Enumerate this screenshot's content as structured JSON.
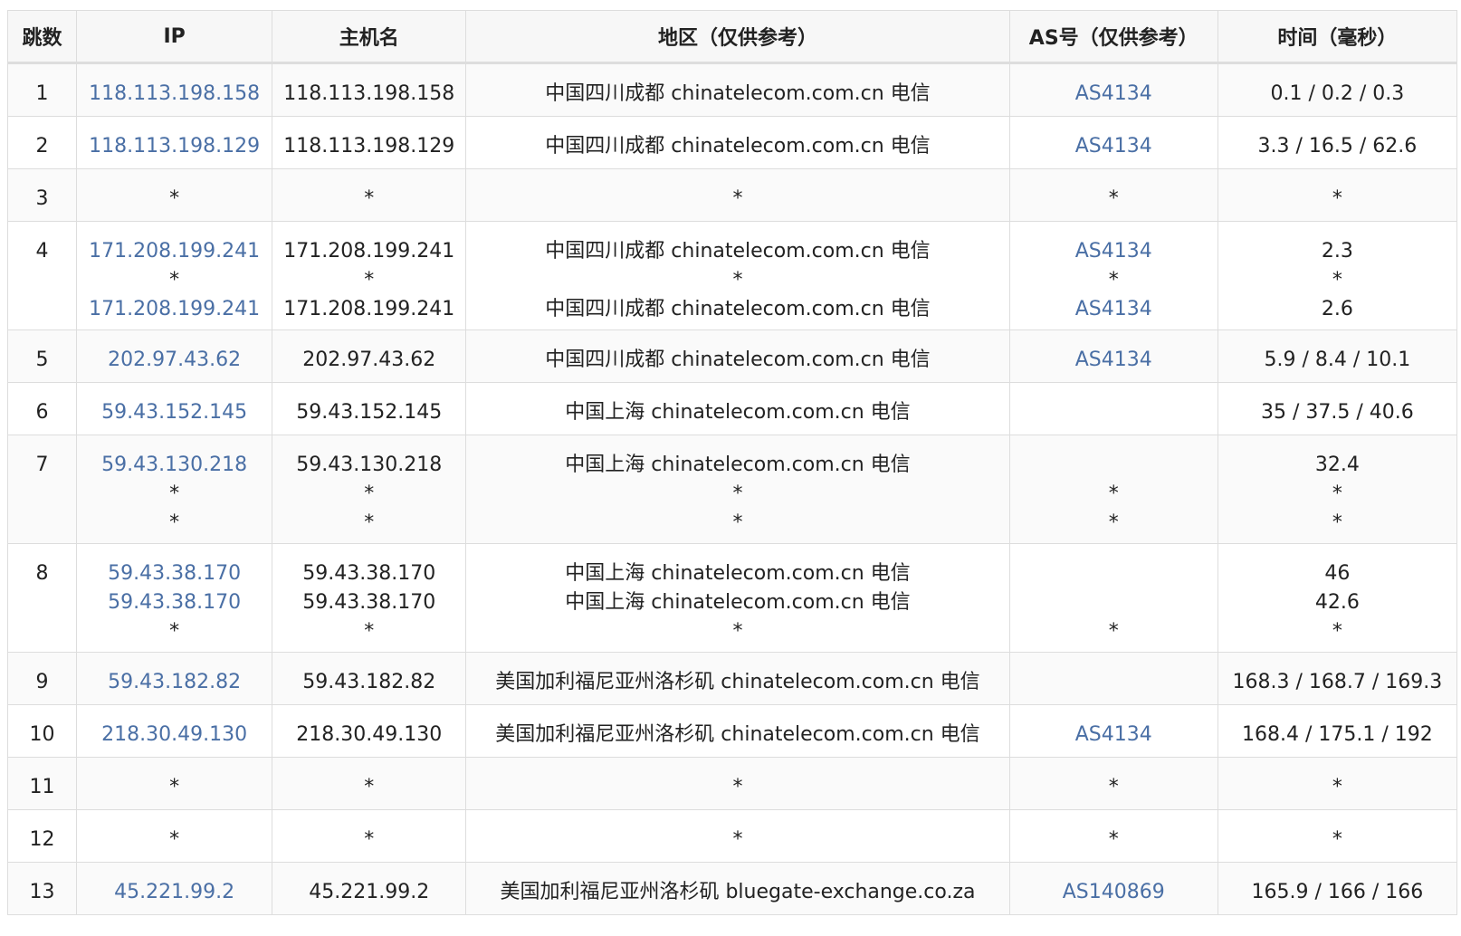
{
  "table": {
    "headers": [
      "跳数",
      "IP",
      "主机名",
      "地区（仅供参考）",
      "AS号（仅供参考）",
      "时间（毫秒）"
    ],
    "rows": [
      {
        "hop": "1",
        "lines": 1,
        "ip": [
          "118.113.198.158"
        ],
        "host": [
          "118.113.198.158"
        ],
        "region": [
          "中国四川成都 chinatelecom.com.cn 电信"
        ],
        "as": [
          "AS4134"
        ],
        "time": [
          "0.1 / 0.2 / 0.3"
        ]
      },
      {
        "hop": "2",
        "lines": 1,
        "ip": [
          "118.113.198.129"
        ],
        "host": [
          "118.113.198.129"
        ],
        "region": [
          "中国四川成都 chinatelecom.com.cn 电信"
        ],
        "as": [
          "AS4134"
        ],
        "time": [
          "3.3 / 16.5 / 62.6"
        ]
      },
      {
        "hop": "3",
        "lines": 1,
        "ip": [
          "*"
        ],
        "host": [
          "*"
        ],
        "region": [
          "*"
        ],
        "as": [
          "*"
        ],
        "time": [
          "*"
        ]
      },
      {
        "hop": "4",
        "lines": 3,
        "ip": [
          "171.208.199.241",
          "*",
          "171.208.199.241"
        ],
        "host": [
          "171.208.199.241",
          "*",
          "171.208.199.241"
        ],
        "region": [
          "中国四川成都 chinatelecom.com.cn 电信",
          "*",
          "中国四川成都 chinatelecom.com.cn 电信"
        ],
        "as": [
          "AS4134",
          "*",
          "AS4134"
        ],
        "time": [
          "2.3",
          "*",
          "2.6"
        ]
      },
      {
        "hop": "5",
        "lines": 1,
        "ip": [
          "202.97.43.62"
        ],
        "host": [
          "202.97.43.62"
        ],
        "region": [
          "中国四川成都 chinatelecom.com.cn 电信"
        ],
        "as": [
          "AS4134"
        ],
        "time": [
          "5.9 / 8.4 / 10.1"
        ]
      },
      {
        "hop": "6",
        "lines": 1,
        "ip": [
          "59.43.152.145"
        ],
        "host": [
          "59.43.152.145"
        ],
        "region": [
          "中国上海 chinatelecom.com.cn 电信"
        ],
        "as": [
          ""
        ],
        "time": [
          "35 / 37.5 / 40.6"
        ]
      },
      {
        "hop": "7",
        "lines": 3,
        "ip": [
          "59.43.130.218",
          "*",
          "*"
        ],
        "host": [
          "59.43.130.218",
          "*",
          "*"
        ],
        "region": [
          "中国上海 chinatelecom.com.cn 电信",
          "*",
          "*"
        ],
        "as": [
          "",
          "*",
          "*"
        ],
        "time": [
          "32.4",
          "*",
          "*"
        ]
      },
      {
        "hop": "8",
        "lines": 3,
        "ip": [
          "59.43.38.170",
          "59.43.38.170",
          "*"
        ],
        "host": [
          "59.43.38.170",
          "59.43.38.170",
          "*"
        ],
        "region": [
          "中国上海 chinatelecom.com.cn 电信",
          "中国上海 chinatelecom.com.cn 电信",
          "*"
        ],
        "as": [
          "",
          "",
          "*"
        ],
        "time": [
          "46",
          "42.6",
          "*"
        ]
      },
      {
        "hop": "9",
        "lines": 1,
        "ip": [
          "59.43.182.82"
        ],
        "host": [
          "59.43.182.82"
        ],
        "region": [
          "美国加利福尼亚州洛杉矶 chinatelecom.com.cn 电信"
        ],
        "as": [
          ""
        ],
        "time": [
          "168.3 / 168.7 / 169.3"
        ]
      },
      {
        "hop": "10",
        "lines": 1,
        "ip": [
          "218.30.49.130"
        ],
        "host": [
          "218.30.49.130"
        ],
        "region": [
          "美国加利福尼亚州洛杉矶 chinatelecom.com.cn 电信"
        ],
        "as": [
          "AS4134"
        ],
        "time": [
          "168.4 / 175.1 / 192"
        ]
      },
      {
        "hop": "11",
        "lines": 1,
        "ip": [
          "*"
        ],
        "host": [
          "*"
        ],
        "region": [
          "*"
        ],
        "as": [
          "*"
        ],
        "time": [
          "*"
        ]
      },
      {
        "hop": "12",
        "lines": 1,
        "ip": [
          "*"
        ],
        "host": [
          "*"
        ],
        "region": [
          "*"
        ],
        "as": [
          "*"
        ],
        "time": [
          "*"
        ]
      },
      {
        "hop": "13",
        "lines": 1,
        "ip": [
          "45.221.99.2"
        ],
        "host": [
          "45.221.99.2"
        ],
        "region": [
          "美国加利福尼亚州洛杉矶 bluegate-exchange.co.za"
        ],
        "as": [
          "AS140869"
        ],
        "time": [
          "165.9 / 166 / 166"
        ]
      }
    ]
  },
  "colors": {
    "link": "#4a6fa5",
    "border": "#dddddd",
    "header_bg": "#f7f7f7",
    "odd_row_bg": "#fafafa"
  }
}
